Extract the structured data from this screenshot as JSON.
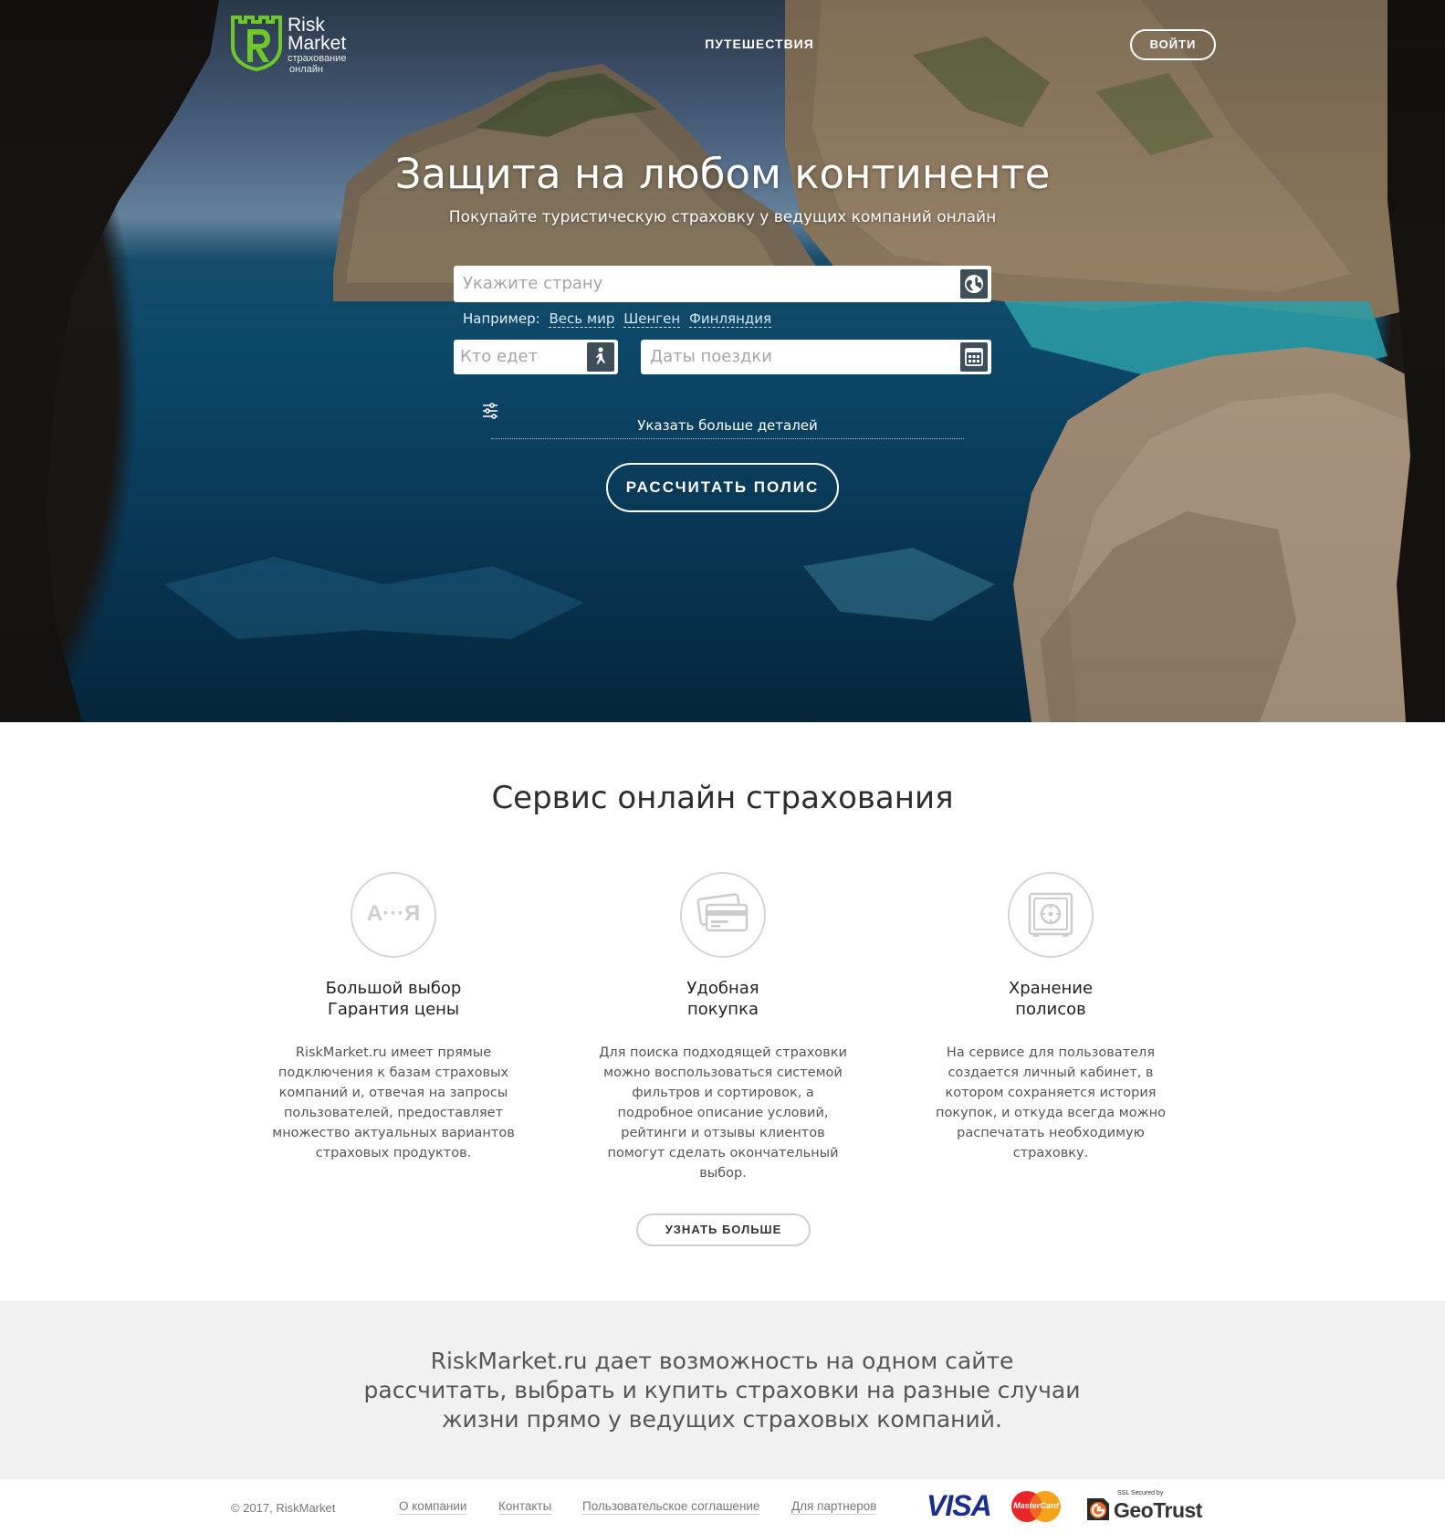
{
  "header": {
    "logo_brand_line1": "Risk",
    "logo_brand_line2": "Market",
    "logo_tagline_line1": "страхование",
    "logo_tagline_line2": "онлайн",
    "nav_travel": "ПУТЕШЕСТВИЯ",
    "login_label": "ВОЙТИ"
  },
  "hero": {
    "title": "Защита на любом континенте",
    "subtitle": "Покупайте туристическую страховку у ведущих компаний онлайн",
    "country_placeholder": "Укажите страну",
    "examples_label": "Например:",
    "examples": [
      "Весь мир",
      "Шенген",
      "Финляндия"
    ],
    "who_placeholder": "Кто едет",
    "dates_placeholder": "Даты поездки",
    "more_details": "Указать больше деталей",
    "calc_button": "РАССЧИТАТЬ ПОЛИС"
  },
  "service": {
    "title": "Сервис онлайн страхования",
    "features": [
      {
        "icon": "a-ya-icon",
        "icon_text": "А···Я",
        "title_line1": "Большой выбор",
        "title_line2": "Гарантия цены",
        "desc": "RiskMarket.ru имеет прямые подключения к базам страховых компаний и, отвечая на запросы пользователей, предоставляет множество актуальных вариантов страховых продуктов."
      },
      {
        "icon": "cards-icon",
        "title_line1": "Удобная",
        "title_line2": "покупка",
        "desc": "Для поиска подходящей страховки можно воспользоваться системой фильтров и сортировок, а подробное описание условий, рейтинги и отзывы клиентов помогут сделать окончательный выбор."
      },
      {
        "icon": "safe-icon",
        "title_line1": "Хранение",
        "title_line2": "полисов",
        "desc": "На сервисе для пользователя создается личный кабинет, в котором сохраняется история покупок, и откуда всегда можно распечатать необходимую страховку."
      }
    ],
    "more_button": "УЗНАТЬ БОЛЬШЕ"
  },
  "band": {
    "text": "RiskMarket.ru дает возможность на одном сайте рассчитать, выбрать и купить страховки на разные случаи жизни прямо у ведущих страховых компаний."
  },
  "footer": {
    "copyright": "© 2017, RiskMarket",
    "links": [
      "О компании",
      "Контакты",
      "Пользовательское соглашение",
      "Для партнеров"
    ],
    "visa": "VISA",
    "mastercard": "MasterCard",
    "geotrust_small": "SSL Secured by",
    "geotrust_big": "GeoTrust"
  },
  "colors": {
    "logo_green": "#6ec82a",
    "icon_dark": "#3e4f5a",
    "band_bg": "#f1f1f1",
    "visa_blue": "#1a2f8c",
    "mc_red": "#e8262a",
    "mc_orange": "#f7a21b"
  }
}
